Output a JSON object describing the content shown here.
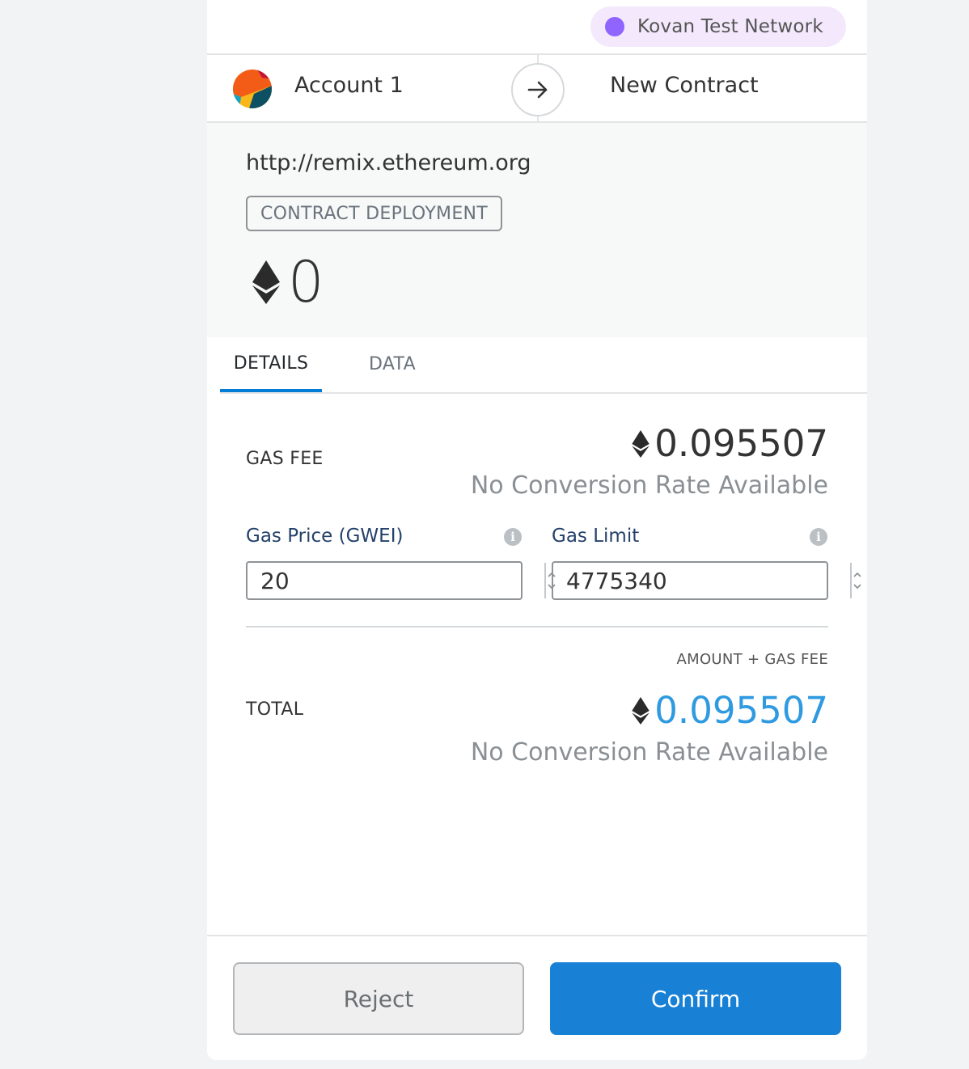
{
  "network": {
    "label": "Kovan Test Network",
    "dot_color": "#9064ff",
    "icon": "network-status-dot"
  },
  "sender": {
    "name": "Account 1",
    "icon": "account-identicon"
  },
  "recipient": {
    "name": "New Contract",
    "arrow_icon": "arrow-right-icon"
  },
  "summary": {
    "origin": "http://remix.ethereum.org",
    "action": "CONTRACT DEPLOYMENT",
    "amount": "0",
    "currency_icon": "ethereum-icon"
  },
  "tabs": [
    {
      "label": "DETAILS",
      "active": true
    },
    {
      "label": "DATA",
      "active": false
    }
  ],
  "details": {
    "gas_fee": {
      "label": "GAS FEE",
      "value": "0.095507",
      "fiat": "No Conversion Rate Available"
    },
    "gas_price": {
      "label": "Gas Price (GWEI)",
      "value": "20",
      "info_icon": "info-icon"
    },
    "gas_limit": {
      "label": "Gas Limit",
      "value": "4775340",
      "info_icon": "info-icon"
    },
    "total": {
      "label": "TOTAL",
      "heading": "AMOUNT + GAS FEE",
      "value": "0.095507",
      "fiat": "No Conversion Rate Available",
      "value_color": "#2f9ae0"
    }
  },
  "footer": {
    "reject_label": "Reject",
    "confirm_label": "Confirm"
  },
  "colors": {
    "accent": "#037dd6",
    "confirm": "#1881d6"
  }
}
